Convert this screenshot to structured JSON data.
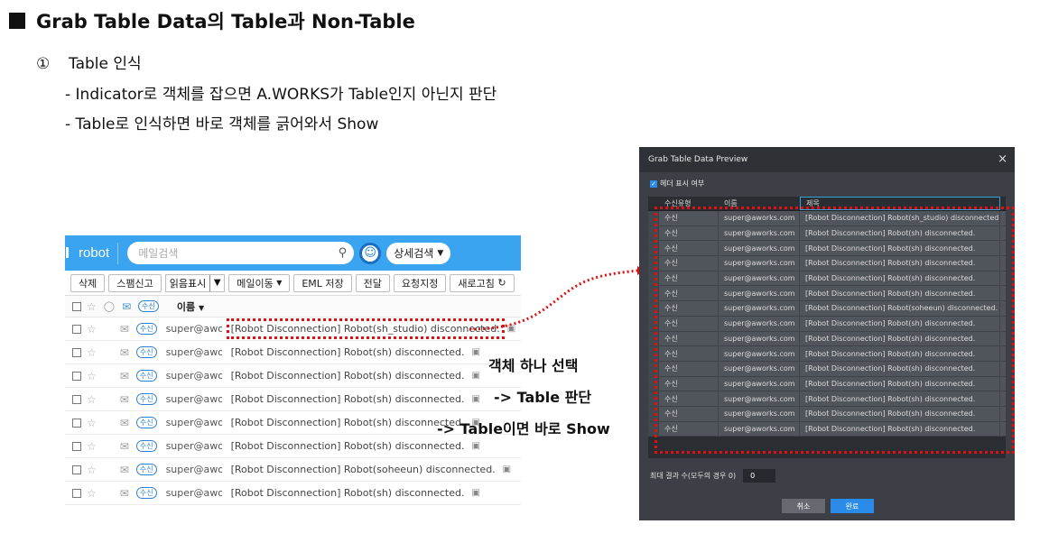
{
  "slide": {
    "title": "Grab Table Data의 Table과 Non-Table",
    "section_num": "①",
    "section_label": "Table 인식",
    "bullets": [
      "- Indicator로 객체를 잡으면 A.WORKS가 Table인지 아닌지 판단",
      "- Table로 인식하면 바로 객체를 긁어와서 Show"
    ]
  },
  "mail": {
    "account": "robot",
    "search_placeholder": "메일검색",
    "advanced_search": "상세검색",
    "toolbar": {
      "delete": "삭제",
      "spam": "스팸신고",
      "read_display": "읽음표시",
      "move": "메일이동",
      "eml_save": "EML 저장",
      "forward": "전달",
      "important": "요청지정",
      "refresh": "새로고침"
    },
    "header": {
      "pill": "수신",
      "name": "이름"
    },
    "rows": [
      {
        "pill": "수신",
        "from": "super@awor···",
        "subject": "[Robot Disconnection] Robot(sh_studio) disconnected."
      },
      {
        "pill": "수신",
        "from": "super@awor···",
        "subject": "[Robot Disconnection] Robot(sh) disconnected."
      },
      {
        "pill": "수신",
        "from": "super@awor···",
        "subject": "[Robot Disconnection] Robot(sh) disconnected."
      },
      {
        "pill": "수신",
        "from": "super@awor···",
        "subject": "[Robot Disconnection] Robot(sh) disconnected."
      },
      {
        "pill": "수신",
        "from": "super@awor···",
        "subject": "[Robot Disconnection] Robot(sh) disconnected."
      },
      {
        "pill": "수신",
        "from": "super@awor···",
        "subject": "[Robot Disconnection] Robot(sh) disconnected."
      },
      {
        "pill": "수신",
        "from": "super@awor···",
        "subject": "[Robot Disconnection] Robot(soheeun) disconnected."
      },
      {
        "pill": "수신",
        "from": "super@awor···",
        "subject": "[Robot Disconnection] Robot(sh) disconnected."
      }
    ]
  },
  "annotations": [
    "객체 하나 선택",
    "-> Table 판단",
    "-> Table이면 바로 Show"
  ],
  "dialog": {
    "title": "Grab Table Data Preview",
    "close": "×",
    "show_header_label": "헤더 표시 여부",
    "columns": [
      "수신유형",
      "이름",
      "제목"
    ],
    "rows": [
      [
        "수신",
        "super@aworks.com",
        "[Robot Disconnection] Robot(sh_studio) disconnected."
      ],
      [
        "수신",
        "super@aworks.com",
        "[Robot Disconnection] Robot(sh) disconnected."
      ],
      [
        "수신",
        "super@aworks.com",
        "[Robot Disconnection] Robot(sh) disconnected."
      ],
      [
        "수신",
        "super@aworks.com",
        "[Robot Disconnection] Robot(sh) disconnected."
      ],
      [
        "수신",
        "super@aworks.com",
        "[Robot Disconnection] Robot(sh) disconnected."
      ],
      [
        "수신",
        "super@aworks.com",
        "[Robot Disconnection] Robot(sh) disconnected."
      ],
      [
        "수신",
        "super@aworks.com",
        "[Robot Disconnection] Robot(soheeun) disconnected."
      ],
      [
        "수신",
        "super@aworks.com",
        "[Robot Disconnection] Robot(sh) disconnected."
      ],
      [
        "수신",
        "super@aworks.com",
        "[Robot Disconnection] Robot(sh) disconnected."
      ],
      [
        "수신",
        "super@aworks.com",
        "[Robot Disconnection] Robot(sh) disconnected."
      ],
      [
        "수신",
        "super@aworks.com",
        "[Robot Disconnection] Robot(sh) disconnected."
      ],
      [
        "수신",
        "super@aworks.com",
        "[Robot Disconnection] Robot(sh) disconnected."
      ],
      [
        "수신",
        "super@aworks.com",
        "[Robot Disconnection] Robot(sh) disconnected."
      ],
      [
        "수신",
        "super@aworks.com",
        "[Robot Disconnection] Robot(sh) disconnected."
      ],
      [
        "수신",
        "super@aworks.com",
        "[Robot Disconnection] Robot(sh) disconnected."
      ]
    ],
    "max_results_label": "최대 결과 수(모두의 경우 0)",
    "max_results_value": "0",
    "cancel": "취소",
    "ok": "완료"
  },
  "colors": {
    "mail_header": "#3aa4f0",
    "dialog_bg": "#3c3f45",
    "accent": "#2a8ce8",
    "highlight": "#e01010"
  }
}
